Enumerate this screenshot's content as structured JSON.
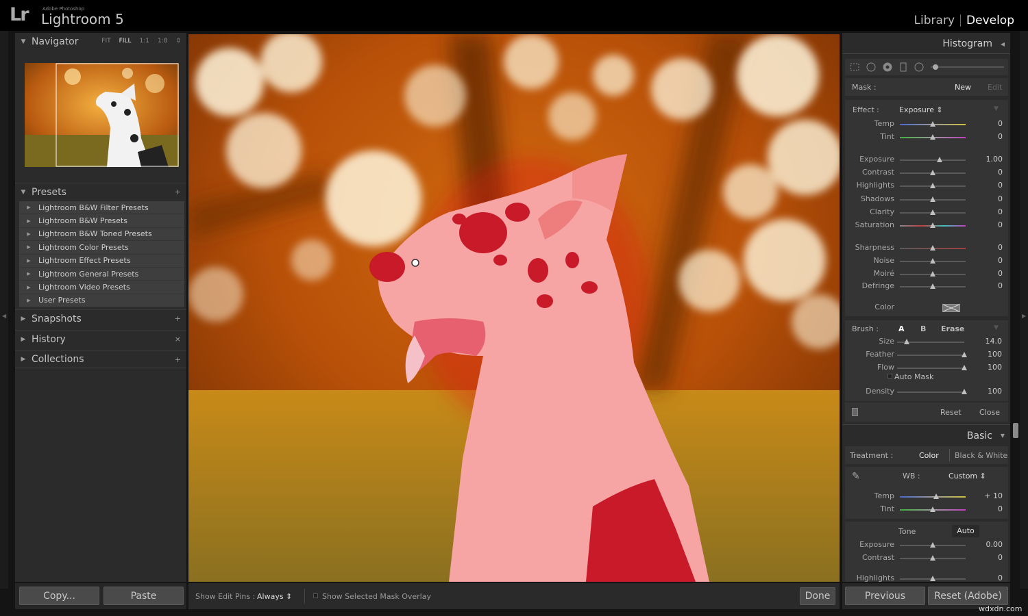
{
  "app": {
    "logo": "Lr",
    "vendor": "Adobe Photoshop",
    "name": "Lightroom 5"
  },
  "modules": {
    "library": "Library",
    "develop": "Develop"
  },
  "navigator": {
    "title": "Navigator",
    "zoom": [
      "FIT",
      "FILL",
      "1:1",
      "1:8"
    ],
    "active_zoom": "FILL"
  },
  "presets": {
    "title": "Presets",
    "add": "+",
    "items": [
      "Lightroom B&W Filter Presets",
      "Lightroom B&W Presets",
      "Lightroom B&W Toned Presets",
      "Lightroom Color Presets",
      "Lightroom Effect Presets",
      "Lightroom General Presets",
      "Lightroom Video Presets",
      "User Presets"
    ]
  },
  "snapshots": {
    "title": "Snapshots",
    "add": "+"
  },
  "history": {
    "title": "History",
    "close": "×"
  },
  "collections": {
    "title": "Collections",
    "add": "+"
  },
  "left_buttons": {
    "copy": "Copy...",
    "paste": "Paste"
  },
  "toolbar": {
    "pins_label": "Show Edit Pins :",
    "pins_value": "Always",
    "overlay_label": "Show Selected Mask Overlay",
    "done": "Done"
  },
  "histogram": {
    "title": "Histogram"
  },
  "brush_panel": {
    "mask_label": "Mask :",
    "mask_new": "New",
    "mask_edit": "Edit",
    "effect_label": "Effect :",
    "effect_value": "Exposure",
    "sliders": [
      {
        "label": "Temp",
        "value": "0",
        "pos": 0.5
      },
      {
        "label": "Tint",
        "value": "0",
        "pos": 0.5
      },
      {
        "label": "Exposure",
        "value": "1.00",
        "pos": 0.6
      },
      {
        "label": "Contrast",
        "value": "0",
        "pos": 0.5
      },
      {
        "label": "Highlights",
        "value": "0",
        "pos": 0.5
      },
      {
        "label": "Shadows",
        "value": "0",
        "pos": 0.5
      },
      {
        "label": "Clarity",
        "value": "0",
        "pos": 0.5
      },
      {
        "label": "Saturation",
        "value": "0",
        "pos": 0.5
      },
      {
        "label": "Sharpness",
        "value": "0",
        "pos": 0.5
      },
      {
        "label": "Noise",
        "value": "0",
        "pos": 0.5
      },
      {
        "label": "Moiré",
        "value": "0",
        "pos": 0.5
      },
      {
        "label": "Defringe",
        "value": "0",
        "pos": 0.5
      }
    ],
    "color_label": "Color",
    "brush_label": "Brush :",
    "brush_a": "A",
    "brush_b": "B",
    "brush_erase": "Erase",
    "brush_sliders": [
      {
        "label": "Size",
        "value": "14.0",
        "pos": 0.14
      },
      {
        "label": "Feather",
        "value": "100",
        "pos": 1.0
      },
      {
        "label": "Flow",
        "value": "100",
        "pos": 1.0
      }
    ],
    "auto_mask": "Auto Mask",
    "density": {
      "label": "Density",
      "value": "100",
      "pos": 1.0
    },
    "reset": "Reset",
    "close": "Close"
  },
  "basic": {
    "title": "Basic",
    "treatment_label": "Treatment :",
    "color": "Color",
    "bw": "Black & White",
    "wb_label": "WB :",
    "wb_value": "Custom",
    "temp": {
      "label": "Temp",
      "value": "+ 10",
      "pos": 0.55
    },
    "tint": {
      "label": "Tint",
      "value": "0",
      "pos": 0.5
    },
    "tone": "Tone",
    "auto": "Auto",
    "exposure": {
      "label": "Exposure",
      "value": "0.00",
      "pos": 0.5
    },
    "contrast": {
      "label": "Contrast",
      "value": "0",
      "pos": 0.5
    },
    "highlights": {
      "label": "Highlights",
      "value": "0",
      "pos": 0.5
    }
  },
  "right_buttons": {
    "previous": "Previous",
    "reset": "Reset (Adobe)"
  },
  "watermark": "wdxdn.com"
}
